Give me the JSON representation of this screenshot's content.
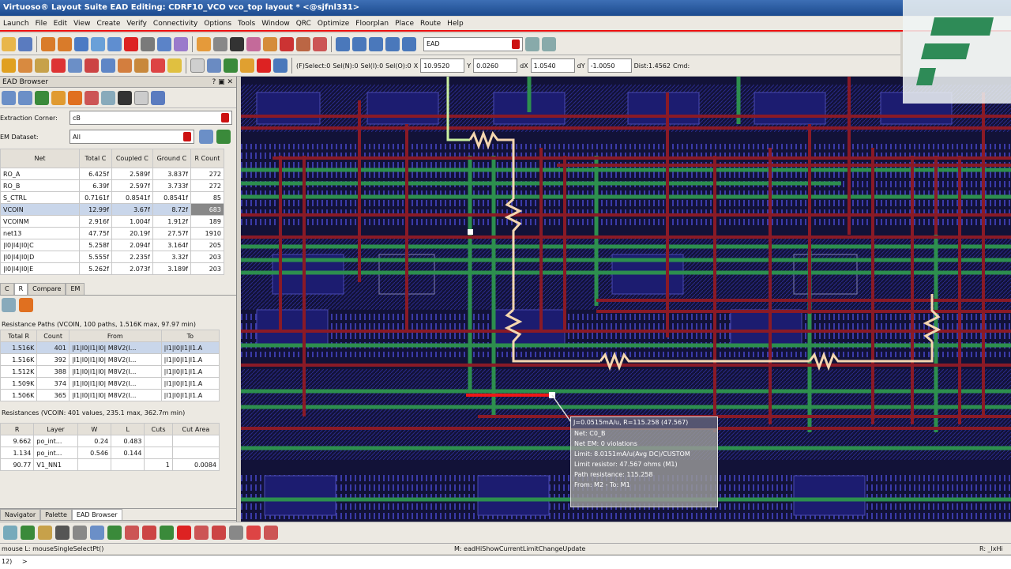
{
  "window": {
    "title": "Virtuoso® Layout Suite EAD Editing: CDRF10_VCO vco_top layout * <@sjfnl331>"
  },
  "menu": [
    "Launch",
    "File",
    "Edit",
    "View",
    "Create",
    "Verify",
    "Connectivity",
    "Options",
    "Tools",
    "Window",
    "QRC",
    "Optimize",
    "Floorplan",
    "Place",
    "Route",
    "Help"
  ],
  "toolbar1": {
    "layer_field": "EAD"
  },
  "toolbar2": {
    "select_mode": "(F)Select:0",
    "sel_n": "Sel(N):0",
    "sel_i": "Sel(I):0",
    "sel_o": "Sel(O):0",
    "x_label": "X",
    "x_value": "10.9520",
    "y_label": "Y",
    "y_value": "0.0260",
    "dx_label": "dX",
    "dx_value": "1.0540",
    "dy_label": "dY",
    "dy_value": "-1.0050",
    "dist": "Dist:1.4562",
    "cmd": "Cmd:"
  },
  "panel": {
    "title": "EAD Browser",
    "corner_label": "Extraction Corner:",
    "corner_value": "cB",
    "em_label": "EM Dataset:",
    "em_value": "All",
    "net_headers": [
      "Net",
      "Total C",
      "Coupled C",
      "Ground C",
      "R Count"
    ],
    "nets": [
      {
        "name": "RO_A",
        "total": "6.425f",
        "coupled": "2.589f",
        "ground": "3.837f",
        "count": "272"
      },
      {
        "name": "RO_B",
        "total": "6.39f",
        "coupled": "2.597f",
        "ground": "3.733f",
        "count": "272"
      },
      {
        "name": "S_CTRL",
        "total": "0.7161f",
        "coupled": "0.8541f",
        "ground": "0.8541f",
        "count": "85"
      },
      {
        "name": "VCOIN",
        "total": "12.99f",
        "coupled": "3.67f",
        "ground": "8.72f",
        "count": "683"
      },
      {
        "name": "VCOINM",
        "total": "2.916f",
        "coupled": "1.004f",
        "ground": "1.912f",
        "count": "189"
      },
      {
        "name": "net13",
        "total": "47.75f",
        "coupled": "20.19f",
        "ground": "27.57f",
        "count": "1910"
      },
      {
        "name": "|I0|I4|I0|C",
        "total": "5.258f",
        "coupled": "2.094f",
        "ground": "3.164f",
        "count": "205"
      },
      {
        "name": "|I0|I4|I0|D",
        "total": "5.555f",
        "coupled": "2.235f",
        "ground": "3.32f",
        "count": "203"
      },
      {
        "name": "|I0|I4|I0|E",
        "total": "5.262f",
        "coupled": "2.073f",
        "ground": "3.189f",
        "count": "203"
      }
    ],
    "tabs": [
      "C",
      "R",
      "Compare",
      "EM"
    ],
    "paths_title": "Resistance Paths (VCOIN, 100 paths, 1.516K max, 97.97 min)",
    "path_headers": [
      "Total R",
      "Count",
      "From",
      "To"
    ],
    "paths": [
      {
        "total": "1.516K",
        "count": "401",
        "from": "|I1|I0|I1|I0| M8V2(I...",
        "to": "|I1|I0|I1|I1.A"
      },
      {
        "total": "1.516K",
        "count": "392",
        "from": "|I1|I0|I1|I0| M8V2(I...",
        "to": "|I1|I0|I1|I1.A"
      },
      {
        "total": "1.512K",
        "count": "388",
        "from": "|I1|I0|I1|I0| M8V2(I...",
        "to": "|I1|I0|I1|I1.A"
      },
      {
        "total": "1.509K",
        "count": "374",
        "from": "|I1|I0|I1|I0| M8V2(I...",
        "to": "|I1|I0|I1|I1.A"
      },
      {
        "total": "1.506K",
        "count": "365",
        "from": "|I1|I0|I1|I0| M8V2(I...",
        "to": "|I1|I0|I1|I1.A"
      }
    ],
    "res_title": "Resistances (VCOIN: 401 values, 235.1 max, 362.7m min)",
    "res_headers": [
      "R",
      "Layer",
      "W",
      "L",
      "Cuts",
      "Cut Area"
    ],
    "res": [
      {
        "r": "9.662",
        "layer": "po_int...",
        "w": "0.24",
        "l": "0.483",
        "cuts": "",
        "area": ""
      },
      {
        "r": "1.134",
        "layer": "po_int...",
        "w": "0.546",
        "l": "0.144",
        "cuts": "",
        "area": ""
      },
      {
        "r": "90.77",
        "layer": "V1_NN1",
        "w": "",
        "l": "",
        "cuts": "1",
        "area": "0.0084"
      }
    ],
    "bottom_tabs": [
      "Navigator",
      "Palette",
      "EAD Browser"
    ]
  },
  "tooltip": {
    "header": "J=0.0515mA/u, R=115.258 (47.567)",
    "lines": [
      "Net: C0_B",
      "Net EM: 0 violations",
      "Limit: 8.0151mA/u(Avg DC)/CUSTOM",
      "Limit resistor: 47.567 ohms (M1)",
      "Path resistance: 115.258",
      "From: M2 - To: M1"
    ]
  },
  "status": {
    "left": "mouse L: mouseSingleSelectPt()",
    "middle": "M: eadHiShowCurrentLimitChangeUpdate",
    "right": "R: _lxHi",
    "prompt": "12)",
    "cmd": ">"
  }
}
